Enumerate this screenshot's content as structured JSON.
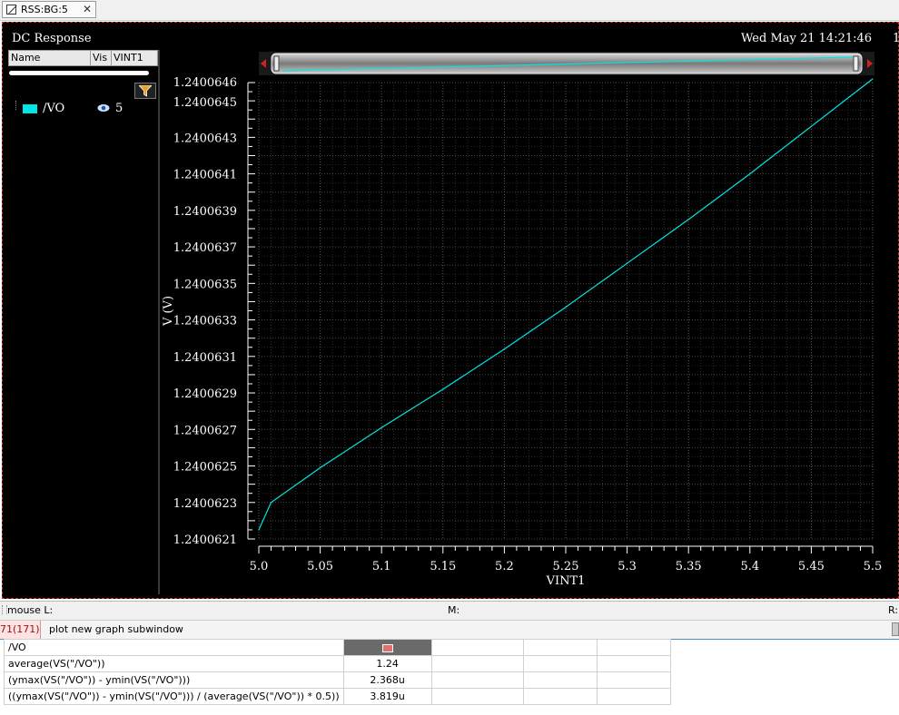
{
  "tab": {
    "label": "RSS:BG:5",
    "close": "✕"
  },
  "plot": {
    "title": "DC Response",
    "datetime": "Wed May 21 14:21:46",
    "corner_number": "1"
  },
  "legend": {
    "columns": [
      "Name",
      "Vis",
      "VINT1"
    ],
    "signal": {
      "name": "/VO",
      "vis_value": "5",
      "color": "#00e6e6"
    },
    "filter_icon": "filter-icon"
  },
  "chart_data": {
    "type": "line",
    "title": "",
    "xlabel": "VINT1",
    "ylabel": "V (V)",
    "xlim": [
      5.0,
      5.5
    ],
    "ylim": [
      1.2400621,
      1.2400646
    ],
    "x_ticks": [
      "5.0",
      "5.05",
      "5.1",
      "5.15",
      "5.2",
      "5.25",
      "5.3",
      "5.35",
      "5.4",
      "5.45",
      "5.5"
    ],
    "y_ticks": [
      "1.2400646",
      "1.2400645",
      "1.2400643",
      "1.2400641",
      "1.2400639",
      "1.2400637",
      "1.2400635",
      "1.2400633",
      "1.2400631",
      "1.2400629",
      "1.2400627",
      "1.2400625",
      "1.2400623",
      "1.2400621"
    ],
    "grid": true,
    "series": [
      {
        "name": "/VO",
        "color": "#00e6e6",
        "x": [
          5.0,
          5.01,
          5.05,
          5.1,
          5.15,
          5.2,
          5.25,
          5.3,
          5.35,
          5.4,
          5.45,
          5.5
        ],
        "y": [
          1.24006215,
          1.2400623,
          1.24006249,
          1.24006271,
          1.24006292,
          1.24006314,
          1.24006337,
          1.24006361,
          1.24006385,
          1.2400641,
          1.24006436,
          1.24006462
        ]
      }
    ]
  },
  "status": {
    "mouse_label": "mouse L:",
    "m_label": "M:",
    "r_label": "R:"
  },
  "command": {
    "count": "71(171)",
    "text": "plot new graph subwindow"
  },
  "calculator": {
    "header": "/VO",
    "rows": [
      {
        "expr": "average(VS(\"/VO\"))",
        "value": "1.24"
      },
      {
        "expr": "(ymax(VS(\"/VO\")) - ymin(VS(\"/VO\")))",
        "value": "2.368u"
      },
      {
        "expr": "((ymax(VS(\"/VO\")) - ymin(VS(\"/VO\"))) / (average(VS(\"/VO\")) * 0.5))",
        "value": "3.819u"
      }
    ]
  }
}
